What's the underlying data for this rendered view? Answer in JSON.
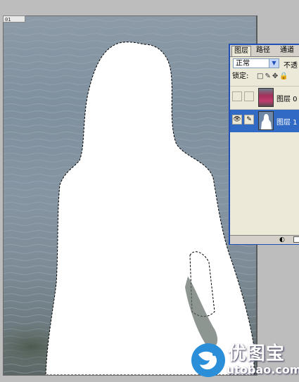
{
  "document": {
    "tag_label": "01"
  },
  "layers_panel": {
    "tabs": [
      {
        "label": "图层",
        "active": true
      },
      {
        "label": "路径",
        "active": false
      },
      {
        "label": "通道",
        "active": false
      }
    ],
    "blend_mode": "正常",
    "opacity_label": "不透",
    "lock_label": "锁定:",
    "layers": [
      {
        "name": "图层 0",
        "selected": false,
        "visible": false
      },
      {
        "name": "图层 1",
        "selected": true,
        "visible": true
      }
    ],
    "accent_color": "#316ac5",
    "frame_color": "#1f4fb7"
  },
  "watermark": {
    "brand": "优图宝",
    "url": "utobao.com"
  }
}
